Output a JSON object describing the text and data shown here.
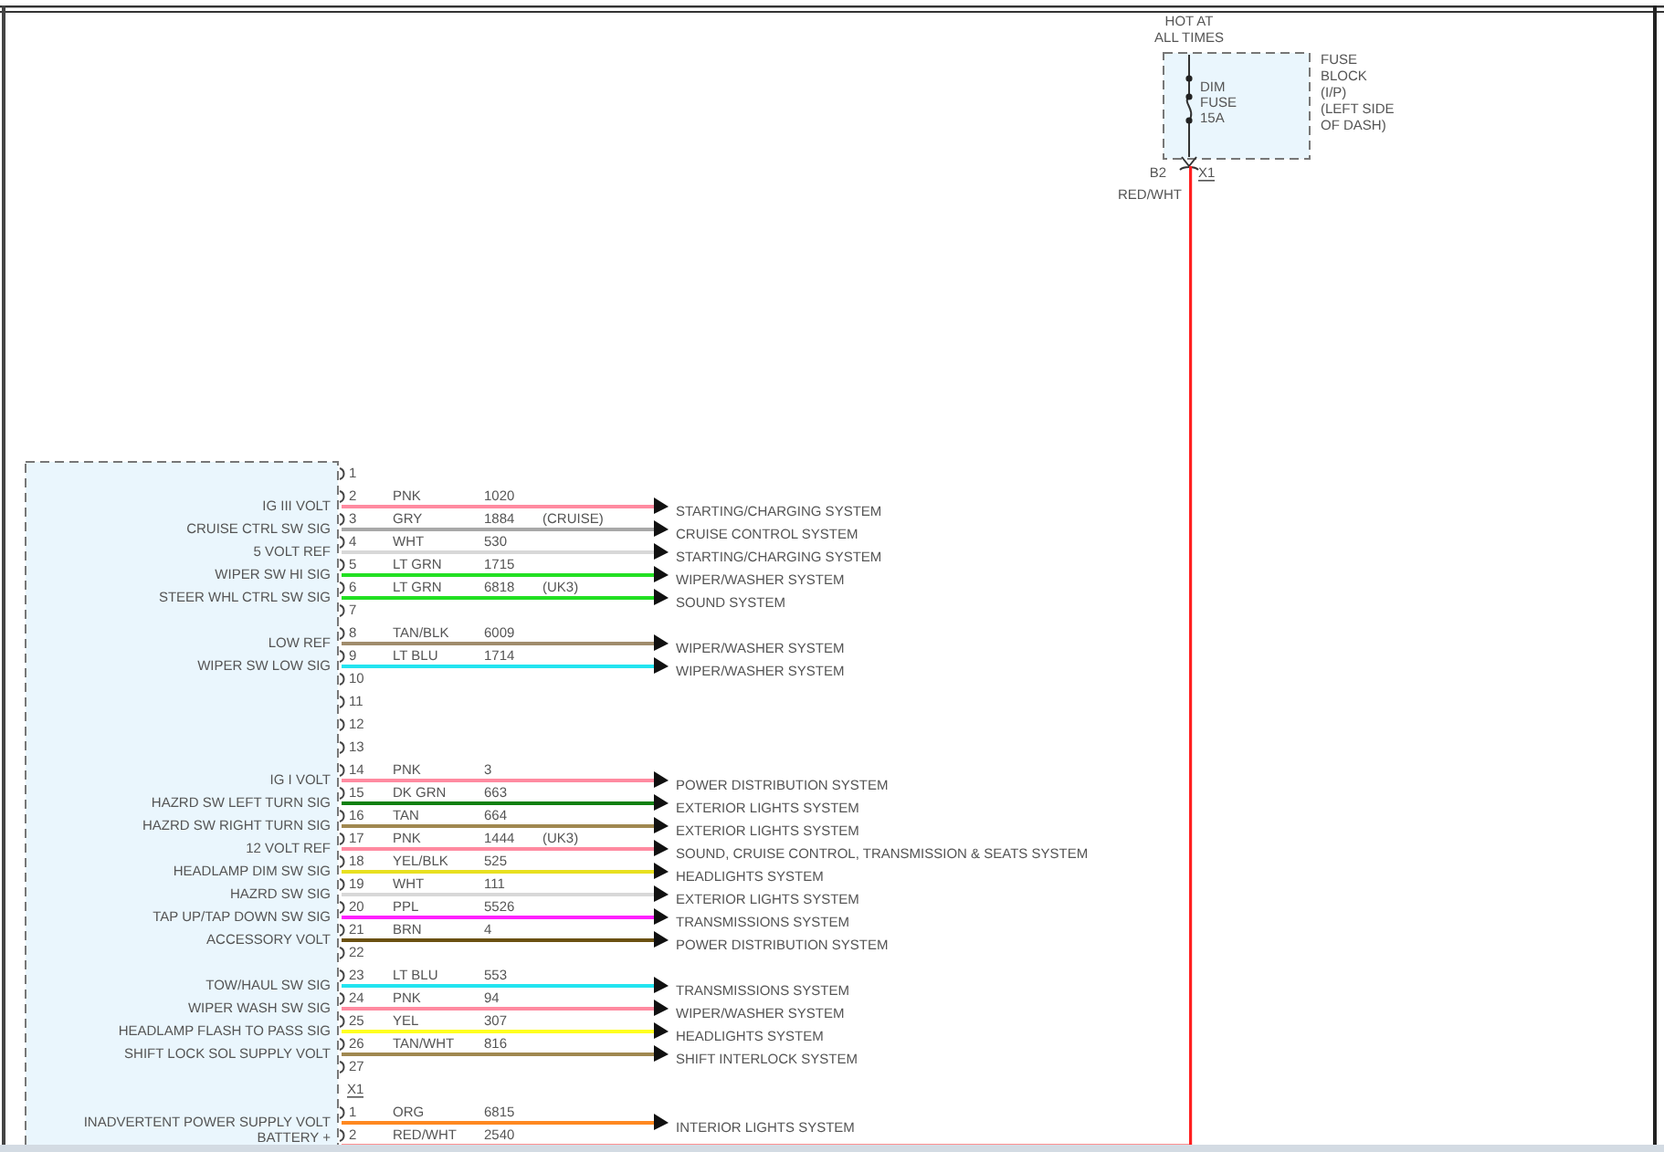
{
  "fuse": {
    "heading": [
      "HOT AT",
      "ALL TIMES"
    ],
    "name": [
      "DIM",
      "FUSE",
      "15A"
    ],
    "location": [
      "FUSE",
      "BLOCK",
      "(I/P)",
      "(LEFT SIDE",
      "OF DASH)"
    ],
    "pin": "B2",
    "connector": "X1",
    "wire_color": "RED/WHT"
  },
  "connectors": [
    {
      "pins": [
        {
          "number": "1"
        },
        {
          "number": "2",
          "label": "IG III VOLT",
          "wire": {
            "color_code": "PNK",
            "circuit": "1020",
            "destination": "STARTING/CHARGING SYSTEM",
            "color": "#ff8aa0"
          }
        },
        {
          "number": "3",
          "label": "CRUISE CTRL SW SIG",
          "wire": {
            "color_code": "GRY",
            "circuit": "1884",
            "note": "(CRUISE)",
            "destination": "CRUISE CONTROL SYSTEM",
            "color": "#a8a8a8"
          }
        },
        {
          "number": "4",
          "label": "5 VOLT REF",
          "wire": {
            "color_code": "WHT",
            "circuit": "530",
            "destination": "STARTING/CHARGING SYSTEM",
            "color": "#d8d8d8"
          }
        },
        {
          "number": "5",
          "label": "WIPER SW HI SIG",
          "wire": {
            "color_code": "LT GRN",
            "circuit": "1715",
            "destination": "WIPER/WASHER SYSTEM",
            "color": "#22e022"
          }
        },
        {
          "number": "6",
          "label": "STEER WHL CTRL SW SIG",
          "wire": {
            "color_code": "LT GRN",
            "circuit": "6818",
            "note": "(UK3)",
            "destination": "SOUND SYSTEM",
            "color": "#22e022"
          }
        },
        {
          "number": "7"
        },
        {
          "number": "8",
          "label": "LOW REF",
          "wire": {
            "color_code": "TAN/BLK",
            "circuit": "6009",
            "destination": "WIPER/WASHER SYSTEM",
            "color": "#a08c6c"
          }
        },
        {
          "number": "9",
          "label": "WIPER SW LOW SIG",
          "wire": {
            "color_code": "LT BLU",
            "circuit": "1714",
            "destination": "WIPER/WASHER SYSTEM",
            "color": "#22e4f0"
          }
        },
        {
          "number": "10"
        },
        {
          "number": "11"
        },
        {
          "number": "12"
        },
        {
          "number": "13"
        },
        {
          "number": "14",
          "label": "IG I VOLT",
          "wire": {
            "color_code": "PNK",
            "circuit": "3",
            "destination": "POWER DISTRIBUTION SYSTEM",
            "color": "#ff8aa0"
          }
        },
        {
          "number": "15",
          "label": "HAZRD SW LEFT TURN SIG",
          "wire": {
            "color_code": "DK GRN",
            "circuit": "663",
            "destination": "EXTERIOR LIGHTS SYSTEM",
            "color": "#108010"
          }
        },
        {
          "number": "16",
          "label": "HAZRD SW RIGHT TURN SIG",
          "wire": {
            "color_code": "TAN",
            "circuit": "664",
            "destination": "EXTERIOR LIGHTS SYSTEM",
            "color": "#a08850"
          }
        },
        {
          "number": "17",
          "label": "12 VOLT REF",
          "wire": {
            "color_code": "PNK",
            "circuit": "1444",
            "note": "(UK3)",
            "destination": "SOUND, CRUISE CONTROL, TRANSMISSION & SEATS SYSTEM",
            "color": "#ff8aa0"
          }
        },
        {
          "number": "18",
          "label": "HEADLAMP DIM SW SIG",
          "wire": {
            "color_code": "YEL/BLK",
            "circuit": "525",
            "destination": "HEADLIGHTS SYSTEM",
            "color": "#e8e020"
          }
        },
        {
          "number": "19",
          "label": "HAZRD SW SIG",
          "wire": {
            "color_code": "WHT",
            "circuit": "111",
            "destination": "EXTERIOR LIGHTS SYSTEM",
            "color": "#d8d8d8"
          }
        },
        {
          "number": "20",
          "label": "TAP UP/TAP DOWN SW SIG",
          "wire": {
            "color_code": "PPL",
            "circuit": "5526",
            "destination": "TRANSMISSIONS SYSTEM",
            "color": "#ff20ff"
          }
        },
        {
          "number": "21",
          "label": "ACCESSORY VOLT",
          "wire": {
            "color_code": "BRN",
            "circuit": "4",
            "destination": "POWER DISTRIBUTION SYSTEM",
            "color": "#6b5010"
          }
        },
        {
          "number": "22"
        },
        {
          "number": "23",
          "label": "TOW/HAUL SW SIG",
          "wire": {
            "color_code": "LT BLU",
            "circuit": "553",
            "destination": "TRANSMISSIONS SYSTEM",
            "color": "#22e4f0"
          }
        },
        {
          "number": "24",
          "label": "WIPER WASH SW SIG",
          "wire": {
            "color_code": "PNK",
            "circuit": "94",
            "destination": "WIPER/WASHER SYSTEM",
            "color": "#ff8aa0"
          }
        },
        {
          "number": "25",
          "label": "HEADLAMP FLASH TO PASS SIG",
          "wire": {
            "color_code": "YEL",
            "circuit": "307",
            "destination": "HEADLIGHTS SYSTEM",
            "color": "#ffff20"
          }
        },
        {
          "number": "26",
          "label": "SHIFT LOCK SOL SUPPLY VOLT",
          "wire": {
            "color_code": "TAN/WHT",
            "circuit": "816",
            "destination": "SHIFT INTERLOCK SYSTEM",
            "color": "#a08850"
          }
        },
        {
          "number": "27"
        }
      ]
    },
    {
      "name": "X1",
      "pins": [
        {
          "number": "1",
          "label": "INADVERTENT POWER SUPPLY VOLT",
          "wire": {
            "color_code": "ORG",
            "circuit": "6815",
            "destination": "INTERIOR LIGHTS SYSTEM",
            "color": "#ff8820"
          }
        },
        {
          "number": "2",
          "label": "BATTERY +",
          "wire": {
            "color_code": "RED/WHT",
            "circuit": "2540",
            "color": "#ff9090"
          }
        }
      ]
    }
  ]
}
